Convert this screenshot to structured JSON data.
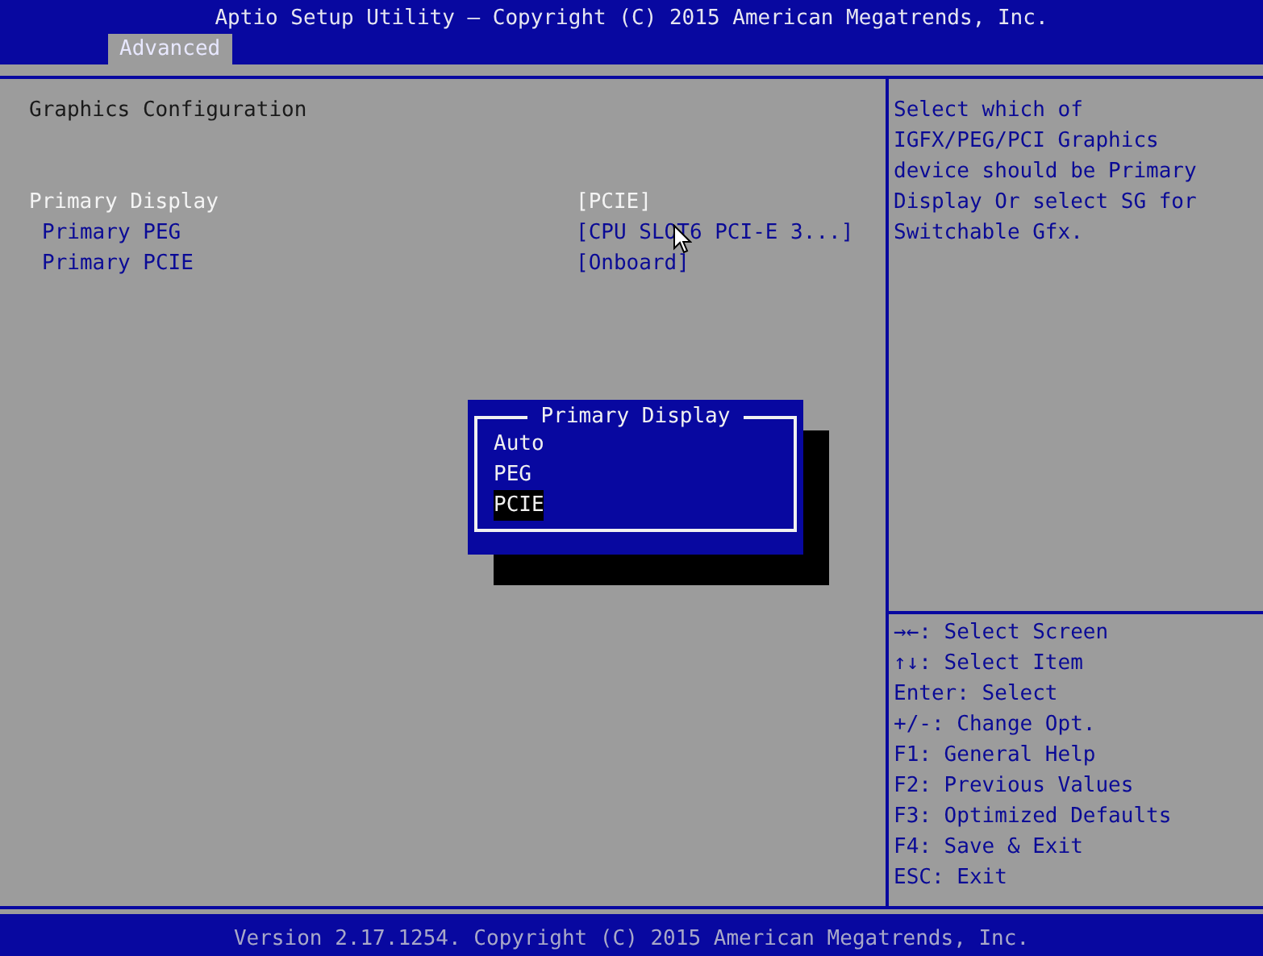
{
  "window": {
    "title": "Aptio Setup Utility – Copyright (C) 2015 American Megatrends, Inc."
  },
  "tabs": [
    {
      "label": "Advanced",
      "selected": true
    }
  ],
  "section_title": "Graphics Configuration",
  "settings": [
    {
      "label": "Primary Display",
      "value": "[PCIE]",
      "selected": true,
      "children": [
        {
          "label": "Primary PEG",
          "value": "[CPU SLOT6 PCI-E 3...]",
          "selected": false
        },
        {
          "label": "Primary PCIE",
          "value": "[Onboard]",
          "selected": false
        }
      ]
    }
  ],
  "help_text": "Select which of IGFX/PEG/PCI Graphics device should be Primary Display Or select SG for Switchable Gfx.",
  "key_help": [
    "→←: Select Screen",
    "↑↓: Select Item",
    "Enter: Select",
    "+/-: Change Opt.",
    "F1: General Help",
    "F2: Previous Values",
    "F3: Optimized Defaults",
    "F4: Save & Exit",
    "ESC: Exit"
  ],
  "popup": {
    "title": "Primary Display",
    "options": [
      {
        "label": "Auto",
        "selected": false
      },
      {
        "label": "PEG",
        "selected": false
      },
      {
        "label": "PCIE",
        "selected": true
      }
    ]
  },
  "status_bar": "Version 2.17.1254. Copyright (C) 2015 American Megatrends, Inc."
}
